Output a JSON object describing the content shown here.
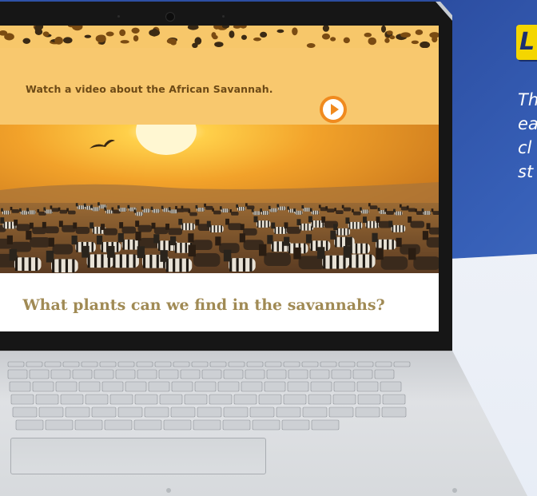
{
  "background": {
    "blue": "#2f52a8",
    "white": "#f3f5f9",
    "badge_color": "#f4d600"
  },
  "side_panel": {
    "badge_text": "L",
    "text_lines": [
      "Th",
      "ea",
      "cl",
      "st"
    ]
  },
  "screen": {
    "banner": {
      "text": "Watch a video about the African Savannah.",
      "play_icon": "play-circle-icon",
      "color": "#f8c86e"
    },
    "hero_image": "savannah-sunset-zebras-photo",
    "question": {
      "title": "What plants can we find in the savannahs?"
    }
  },
  "colors": {
    "banner_text": "#6d4a16",
    "play": "#f08a1e",
    "question_text": "#a08a54"
  }
}
